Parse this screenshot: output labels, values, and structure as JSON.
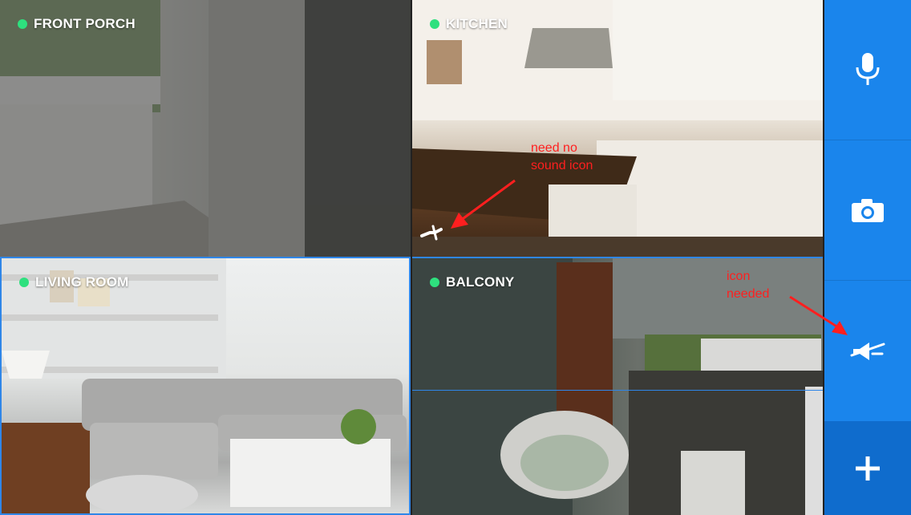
{
  "feeds": [
    {
      "label": "FRONT PORCH",
      "status": "live"
    },
    {
      "label": "KITCHEN",
      "status": "live"
    },
    {
      "label": "LIVING ROOM",
      "status": "live",
      "selected": true
    },
    {
      "label": "BALCONY",
      "status": "live"
    }
  ],
  "annotations": {
    "kitchen_note_line1": "need no",
    "kitchen_note_line2": "sound icon",
    "panel_note_line1": "icon",
    "panel_note_line2": "needed"
  },
  "controls": [
    {
      "name": "microphone",
      "icon": "microphone-icon"
    },
    {
      "name": "snapshot",
      "icon": "camera-icon"
    },
    {
      "name": "mute",
      "icon": "speaker-muted-icon"
    },
    {
      "name": "add",
      "icon": "plus-icon"
    }
  ],
  "colors": {
    "accent": "#1a85ec",
    "accent_dark": "#0f6ccd",
    "live_dot": "#2ee07e",
    "annotation": "#ff1f1f",
    "selection_border": "#2f86e8"
  }
}
